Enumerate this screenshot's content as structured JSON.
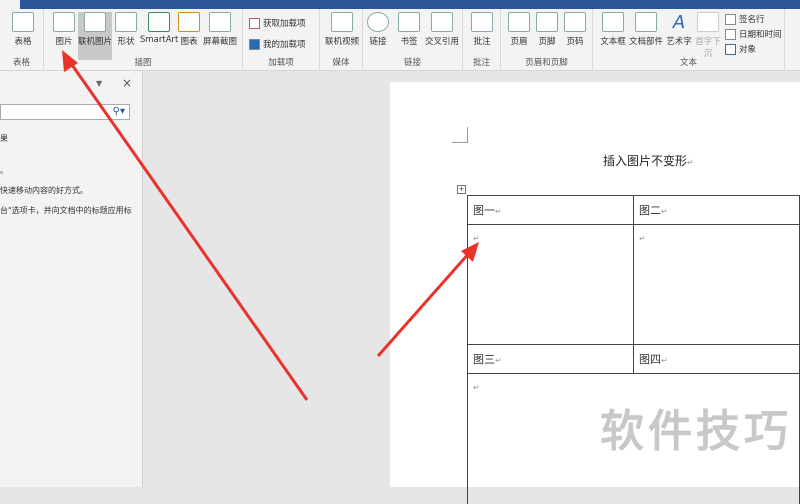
{
  "ribbon": {
    "groups": [
      {
        "label": "表格",
        "buttons": [
          "表格"
        ]
      },
      {
        "label": "插图",
        "buttons": [
          "图片",
          "联机图片",
          "形状",
          "SmartArt",
          "图表",
          "屏幕截图"
        ]
      },
      {
        "label": "加载项",
        "buttons": [
          "获取加载项",
          "我的加载项"
        ]
      },
      {
        "label": "媒体",
        "buttons": [
          "联机视频"
        ]
      },
      {
        "label": "链接",
        "buttons": [
          "链接",
          "书签",
          "交叉引用"
        ]
      },
      {
        "label": "批注",
        "buttons": [
          "批注"
        ]
      },
      {
        "label": "页眉和页脚",
        "buttons": [
          "页眉",
          "页脚",
          "页码"
        ]
      },
      {
        "label": "文本",
        "buttons": [
          "文本框",
          "文档部件",
          "艺术字",
          "首字下沉",
          "签名行",
          "日期和时间",
          "对象"
        ]
      }
    ]
  },
  "nav": {
    "lines": [
      "果",
      "。",
      "快速移动内容的好方式。",
      "台\"选项卡，并向文档中的标题应用标"
    ]
  },
  "doc": {
    "title": "插入图片不变形",
    "cells": [
      "图一",
      "图二",
      "图三",
      "图四"
    ]
  },
  "watermark": "软件技巧",
  "colors": {
    "arrow": "#e8322a",
    "tabbar": "#2b579a"
  }
}
